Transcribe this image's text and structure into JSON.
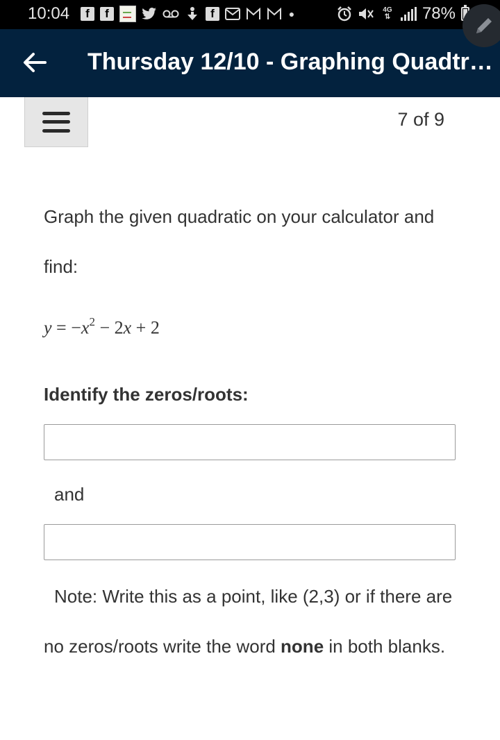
{
  "status_bar": {
    "time": "10:04",
    "battery": "78%",
    "left_icons": [
      "facebook-icon",
      "facebook-icon",
      "map-thumbnail-icon",
      "twitter-icon",
      "voicemail-icon",
      "download-icon",
      "facebook-icon",
      "email-icon",
      "gmail-icon",
      "gmail-icon",
      "dot-icon"
    ],
    "right_icons": [
      "alarm-icon",
      "mute-icon",
      "4g-icon",
      "signal-icon",
      "battery-icon"
    ],
    "data_badge": "4G"
  },
  "app_bar": {
    "title": "Thursday 12/10 - Graphing Quadtra...",
    "background_color": "#03223e"
  },
  "toolbar": {
    "page_counter": "7 of 9"
  },
  "question": {
    "prompt": "Graph the given quadratic on your calculator and find:",
    "equation": {
      "lhs": "y",
      "equals": "=",
      "term1_sign": "−",
      "term1_var": "x",
      "term1_exp": "2",
      "op2": "−",
      "term2": "2x",
      "op3": "+",
      "term3": "2"
    },
    "label": "Identify the zeros/roots:",
    "input1_value": "",
    "connector": "and",
    "input2_value": "",
    "note_prefix": "Note: Write this as a point, like (2,3) or if there are no zeros/roots write the word",
    "note_bold": "none",
    "note_suffix": "in both blanks."
  }
}
